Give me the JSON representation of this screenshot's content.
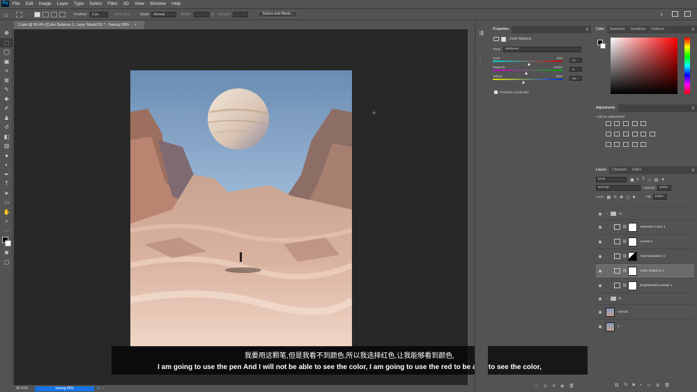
{
  "app": {
    "logo": "Ps",
    "menu": [
      "File",
      "Edit",
      "Image",
      "Layer",
      "Type",
      "Select",
      "Filter",
      "3D",
      "View",
      "Window",
      "Help"
    ]
  },
  "options": {
    "feather_label": "Feather:",
    "feather_value": "0 px",
    "antialias_label": "Anti-alias",
    "style_label": "Style:",
    "style_value": "Normal",
    "width_label": "Width:",
    "height_label": "Height:",
    "select_mask_label": "Select and Mask..."
  },
  "document": {
    "tab_title": "2.psd @ 56.4% (Color Balance 1, Layer Mask/16) * - Saving 99%",
    "tab_close": "×"
  },
  "status": {
    "zoom": "56.41%",
    "progress_label": "Saving 99%",
    "progress": 0.99
  },
  "subtitles": {
    "zh": "我要用这颗笔,但是我看不到颜色,所以我选择红色,让我能够看到颜色,",
    "en": "I am going to use the pen And I will not be able to see the color, I am going to use the red to be able to see the color,"
  },
  "properties": {
    "tab": "Properties",
    "title": "Color Balance",
    "tone_label": "Tone:",
    "tone_value": "Midtones",
    "sliders": [
      {
        "left": "Cyan",
        "right": "Red",
        "value": "+4",
        "pos": 0.52
      },
      {
        "left": "Magenta",
        "right": "Green",
        "value": "-3",
        "pos": 0.48
      },
      {
        "left": "Yellow",
        "right": "Blue",
        "value": "-10",
        "pos": 0.44
      }
    ],
    "preserve_label": "Preserve Luminosity"
  },
  "color_panel": {
    "tabs": [
      "Color",
      "Swatches",
      "Gradients",
      "Patterns"
    ],
    "hue": "#ff0000"
  },
  "adjustments": {
    "tab": "Adjustments",
    "hint": "Add an adjustment"
  },
  "layers": {
    "tabs": [
      "Layers",
      "Channels",
      "Paths"
    ],
    "kind_label": "Kind",
    "blend_mode": "Normal",
    "opacity_label": "Opacity:",
    "opacity_value": "100%",
    "lock_label": "Lock:",
    "fill_label": "Fill:",
    "fill_value": "100%",
    "items": [
      {
        "name": "cc",
        "type": "group"
      },
      {
        "name": "Selective Color 1",
        "type": "adjustment"
      },
      {
        "name": "Levels 1",
        "type": "adjustment"
      },
      {
        "name": "Hue/Saturation 1",
        "type": "adjustment"
      },
      {
        "name": "Color Balance 1",
        "type": "adjustment",
        "selected": true
      },
      {
        "name": "Brightness/Contrast 1",
        "type": "adjustment"
      },
      {
        "name": "fx",
        "type": "group"
      },
      {
        "name": "normal",
        "type": "image"
      },
      {
        "name": "1",
        "type": "image"
      }
    ]
  },
  "colors": {
    "accent": "#1473e6",
    "logo_red": "#e42a2a"
  }
}
